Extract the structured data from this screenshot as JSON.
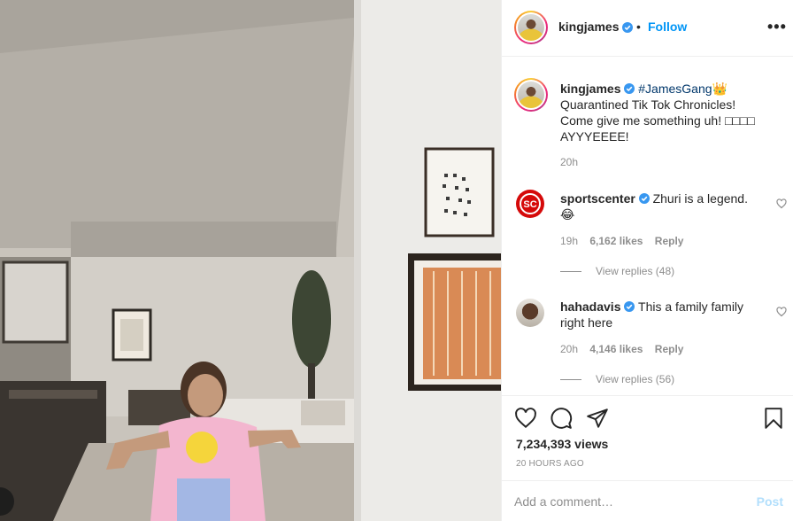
{
  "post": {
    "username": "kingjames",
    "follow_label": "Follow",
    "more_label": "•••"
  },
  "caption": {
    "username": "kingjames",
    "hashtag": "#JamesGang",
    "hashtag_emoji": "👑",
    "line1": "Quarantined Tik Tok Chronicles!",
    "line2": "Come give me something uh! □□□□",
    "line3": "AYYYEEEE!",
    "time": "20h"
  },
  "comments": [
    {
      "username": "sportscenter",
      "text": "Zhuri is a legend.",
      "emoji": "😂",
      "time": "19h",
      "likes": "6,162 likes",
      "reply_label": "Reply",
      "view_replies": "View replies (48)",
      "avatar_text": "SC"
    },
    {
      "username": "hahadavis",
      "text": "This a family family",
      "text2": "right here",
      "time": "20h",
      "likes": "4,146 likes",
      "reply_label": "Reply",
      "view_replies": "View replies (56)"
    }
  ],
  "stats": {
    "views": "7,234,393 views",
    "ago": "20 HOURS AGO"
  },
  "composer": {
    "placeholder": "Add a comment…",
    "post_label": "Post"
  },
  "colors": {
    "link_blue": "#0095f6",
    "verified_blue": "#3897f0",
    "sportscenter_red": "#d50a0a"
  }
}
